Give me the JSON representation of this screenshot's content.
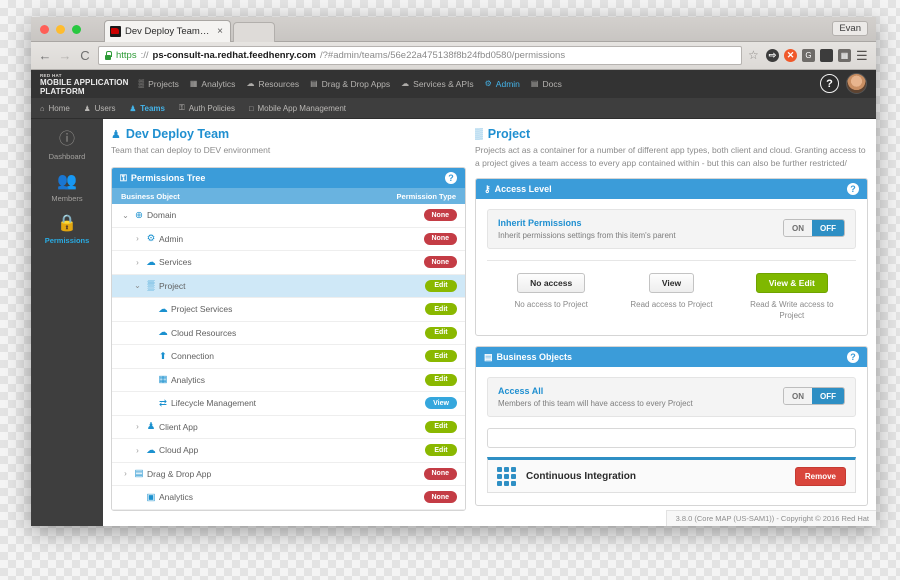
{
  "browser": {
    "tab_title": "Dev Deploy Team Project",
    "tab_close": "×",
    "window_user": "Evan",
    "back_icon": "←",
    "forward_icon": "→",
    "reload_icon": "C",
    "url": {
      "scheme": "https",
      "separator": "://",
      "host": "ps-consult-na.redhat.feedhenry.com",
      "path": "/?#admin/teams/56e22a475138f8b24fbd0580/permissions"
    },
    "omni_icons": [
      "star-icon",
      "extension-g-icon",
      "extension-orange-icon",
      "extension-grammarly-icon",
      "extension-pocket-icon",
      "extension-reader-icon",
      "menu-icon"
    ],
    "star_glyph": "☆",
    "menu_glyph": "☰"
  },
  "topnav": {
    "brand_line1": "RED HAT",
    "brand_line2": "MOBILE APPLICATION",
    "brand_line3": "PLATFORM",
    "items": [
      {
        "label": "Projects",
        "icon": "▒",
        "icon_name": "grid-icon",
        "active": false
      },
      {
        "label": "Analytics",
        "icon": "▦",
        "icon_name": "chart-icon",
        "active": false
      },
      {
        "label": "Resources",
        "icon": "☁",
        "icon_name": "cloud-icon",
        "active": false
      },
      {
        "label": "Drag & Drop Apps",
        "icon": "▤",
        "icon_name": "list-icon",
        "active": false
      },
      {
        "label": "Services & APIs",
        "icon": "☁",
        "icon_name": "services-cloud-icon",
        "active": false
      },
      {
        "label": "Admin",
        "icon": "⚙",
        "icon_name": "gears-icon",
        "active": true
      },
      {
        "label": "Docs",
        "icon": "▤",
        "icon_name": "book-icon",
        "active": false
      }
    ],
    "help_label": "?",
    "avatar_name": "user-avatar"
  },
  "subnav": {
    "items": [
      {
        "label": "Home",
        "icon": "⌂",
        "icon_name": "home-icon",
        "active": false
      },
      {
        "label": "Users",
        "icon": "♟",
        "icon_name": "user-icon",
        "active": false
      },
      {
        "label": "Teams",
        "icon": "♟",
        "icon_name": "team-icon",
        "active": true
      },
      {
        "label": "Auth Policies",
        "icon": "⚿",
        "icon_name": "lock-icon",
        "active": false
      },
      {
        "label": "Mobile App Management",
        "icon": "□",
        "icon_name": "device-icon",
        "active": false
      }
    ]
  },
  "rail": {
    "items": [
      {
        "label": "Dashboard",
        "icon": "ℹ",
        "icon_name": "info-icon",
        "active": false
      },
      {
        "label": "Members",
        "icon": "♟",
        "icon_name": "members-icon",
        "active": false
      },
      {
        "label": "Permissions",
        "icon": "⚿",
        "icon_name": "padlock-icon",
        "active": true
      }
    ]
  },
  "left": {
    "page_title": "Dev Deploy Team",
    "page_title_icon": "♟",
    "page_sub": "Team that can deploy to DEV environment",
    "panel_title": "Permissions Tree",
    "panel_icon": "⚿",
    "help_label": "?",
    "col_object": "Business Object",
    "col_permission": "Permission Type",
    "rows": [
      {
        "label": "Domain",
        "icon": "⊕",
        "icon_name": "domain-globe-icon",
        "twist": "⌄",
        "indent": 0,
        "badge": "None",
        "badge_kind": "none",
        "selected": false
      },
      {
        "label": "Admin",
        "icon": "⚙",
        "icon_name": "admin-gear-icon",
        "twist": "›",
        "indent": 1,
        "badge": "None",
        "badge_kind": "none",
        "selected": false
      },
      {
        "label": "Services",
        "icon": "☁",
        "icon_name": "services-cloud-icon",
        "twist": "›",
        "indent": 1,
        "badge": "None",
        "badge_kind": "none",
        "selected": false
      },
      {
        "label": "Project",
        "icon": "▒",
        "icon_name": "project-grid-icon",
        "twist": "⌄",
        "indent": 1,
        "badge": "Edit",
        "badge_kind": "edit",
        "selected": true
      },
      {
        "label": "Project Services",
        "icon": "☁",
        "icon_name": "project-services-cloud-icon",
        "twist": "",
        "indent": 2,
        "badge": "Edit",
        "badge_kind": "edit",
        "selected": false
      },
      {
        "label": "Cloud Resources",
        "icon": "☁",
        "icon_name": "cloud-resources-icon",
        "twist": "",
        "indent": 2,
        "badge": "Edit",
        "badge_kind": "edit",
        "selected": false
      },
      {
        "label": "Connection",
        "icon": "⬆",
        "icon_name": "connection-upload-icon",
        "twist": "",
        "indent": 2,
        "badge": "Edit",
        "badge_kind": "edit",
        "selected": false
      },
      {
        "label": "Analytics",
        "icon": "▦",
        "icon_name": "analytics-chart-icon",
        "twist": "",
        "indent": 2,
        "badge": "Edit",
        "badge_kind": "edit",
        "selected": false
      },
      {
        "label": "Lifecycle Management",
        "icon": "⇄",
        "icon_name": "lifecycle-shuffle-icon",
        "twist": "",
        "indent": 2,
        "badge": "View",
        "badge_kind": "view",
        "selected": false
      },
      {
        "label": "Client App",
        "icon": "♟",
        "icon_name": "client-app-user-icon",
        "twist": "›",
        "indent": 1,
        "badge": "Edit",
        "badge_kind": "edit",
        "selected": false
      },
      {
        "label": "Cloud App",
        "icon": "☁",
        "icon_name": "cloud-app-icon",
        "twist": "›",
        "indent": 1,
        "badge": "Edit",
        "badge_kind": "edit",
        "selected": false
      },
      {
        "label": "Drag & Drop App",
        "icon": "▤",
        "icon_name": "drag-drop-app-icon",
        "twist": "›",
        "indent": 0,
        "badge": "None",
        "badge_kind": "none",
        "selected": false
      },
      {
        "label": "Analytics",
        "icon": "▣",
        "icon_name": "analytics-icon",
        "twist": "",
        "indent": 1,
        "badge": "None",
        "badge_kind": "none",
        "selected": false
      }
    ]
  },
  "right": {
    "page_title": "Project",
    "page_title_icon": "▒",
    "page_sub": "Projects act as a container for a number of different app types, both client and cloud. Granting access to a project gives a team access to every app contained within - but this can also be further restricted/",
    "access_level": {
      "panel_title": "Access Level",
      "panel_icon": "⚷",
      "help_label": "?",
      "inherit_title": "Inherit Permissions",
      "inherit_sub": "Inherit permissions settings from this item's parent",
      "toggle_on": "ON",
      "toggle_off": "OFF",
      "toggle_state": "OFF",
      "choices": [
        {
          "label": "No access",
          "desc": "No access to Project",
          "style": "plain"
        },
        {
          "label": "View",
          "desc": "Read access to Project",
          "style": "plain"
        },
        {
          "label": "View & Edit",
          "desc": "Read & Write access to Project",
          "style": "green"
        }
      ]
    },
    "business_objects": {
      "panel_title": "Business Objects",
      "panel_icon": "▤",
      "help_label": "?",
      "access_all_title": "Access All",
      "access_all_sub": "Members of this team will have access to every Project",
      "toggle_on": "ON",
      "toggle_off": "OFF",
      "toggle_state": "OFF",
      "search_value": "",
      "search_placeholder": "",
      "cards": [
        {
          "name": "Continuous Integration",
          "remove_label": "Remove",
          "icon_name": "project-grid-icon"
        }
      ]
    }
  },
  "footer": {
    "text": "3.8.0 (Core MAP (US-SAM1)) - Copyright © 2016 Red Hat"
  },
  "colors": {
    "brand_blue": "#1f8fd0",
    "panel_blue": "#3b9cd9",
    "panel_blue_light": "#69b3e0",
    "badge_none": "#c43c45",
    "badge_edit": "#8ab800",
    "badge_view": "#35a7dd",
    "toggle_on_blue": "#2e8fc4",
    "green_button": "#7fb800",
    "remove_red": "#d9453c",
    "dark_nav": "#333333",
    "sub_nav": "#3e3e3e"
  }
}
